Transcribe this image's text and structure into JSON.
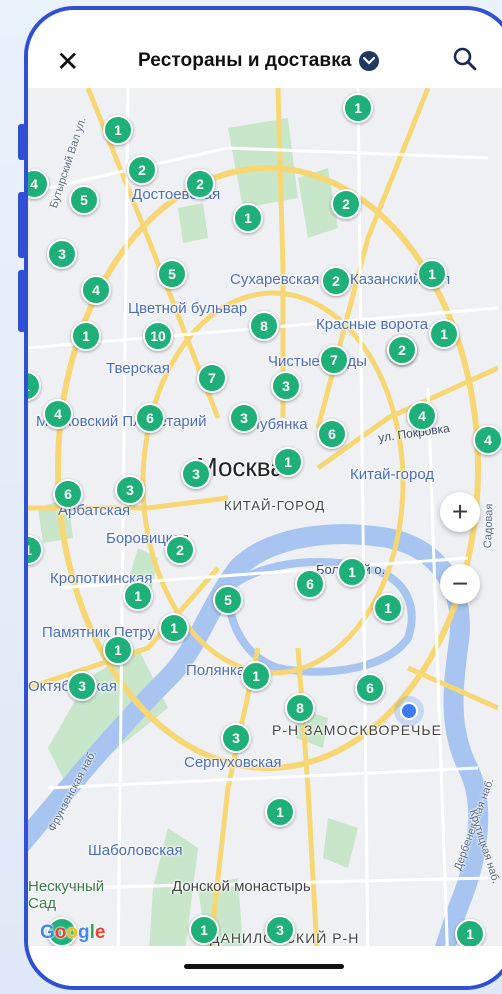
{
  "header": {
    "close_label": "✕",
    "title": "Рестораны и доставка"
  },
  "map": {
    "labels": {
      "dostoevskaya": "Достоевская",
      "sukharevskaya": "Сухаревская",
      "kazansky": "Казанский вал",
      "tsvetnoy": "Цветной бульвар",
      "krasnye_vorota": "Красные ворота",
      "tverskaya": "Тверская",
      "chistye_prudy": "Чистые пруды",
      "conservatory": "Московский Планетарий",
      "lubyanka": "Лубянка",
      "ul_pokrovka": "ул. Покровка",
      "moscow": "Москва",
      "kitay_gorod_station": "Китай-город",
      "kitay_gorod_district": "КИТАЙ-ГОРОД",
      "arbatskaya": "Арбатская",
      "borovitskaya": "Боровицкая",
      "bolshoy_o": "Большой о.",
      "kropotkinskaya": "Кропоткинская",
      "pamyatnik": "Памятник Петру",
      "oktyabrskaya": "Октябрьская",
      "polyanka": "Полянка",
      "zamoskvorechye": "Р-Н ЗАМОСКВОРЕЧЬЕ",
      "serpukhovskaya": "Серпуховская",
      "shabolovskaya": "Шаболовская",
      "donskoy": "Донской монастырь",
      "neskuchny": "Нескучный Сад",
      "danilovsky": "ДАНИЛОВСКИЙ Р-Н",
      "butyrsky": "Бутырский Вал ул.",
      "frunzenskaya": "Фрунзенская наб.",
      "sadovaya": "Садовая",
      "derbenevskaya": "Дербеневская наб.",
      "krutitskaya": "Крутицкая наб."
    },
    "cluster_counts": [
      1,
      1,
      2,
      2,
      5,
      2,
      1,
      2,
      3,
      5,
      4,
      2,
      1,
      1,
      8,
      1,
      10,
      2,
      1,
      7,
      7,
      3,
      4,
      6,
      3,
      6,
      4,
      4,
      1,
      6,
      3,
      3,
      2,
      1,
      6,
      1,
      1,
      5,
      1,
      1,
      1,
      3,
      1,
      8,
      6,
      3,
      1,
      1,
      3,
      1,
      1,
      4
    ]
  },
  "zoom": {
    "in_label": "+",
    "out_label": "−"
  },
  "attribution": [
    "G",
    "o",
    "o",
    "g",
    "l",
    "e"
  ],
  "colors": {
    "cluster": "#1fb07a",
    "frame": "#2f50d6",
    "water": "#a7c5f0",
    "park": "#c8e6c9",
    "road": "#f7d774"
  }
}
